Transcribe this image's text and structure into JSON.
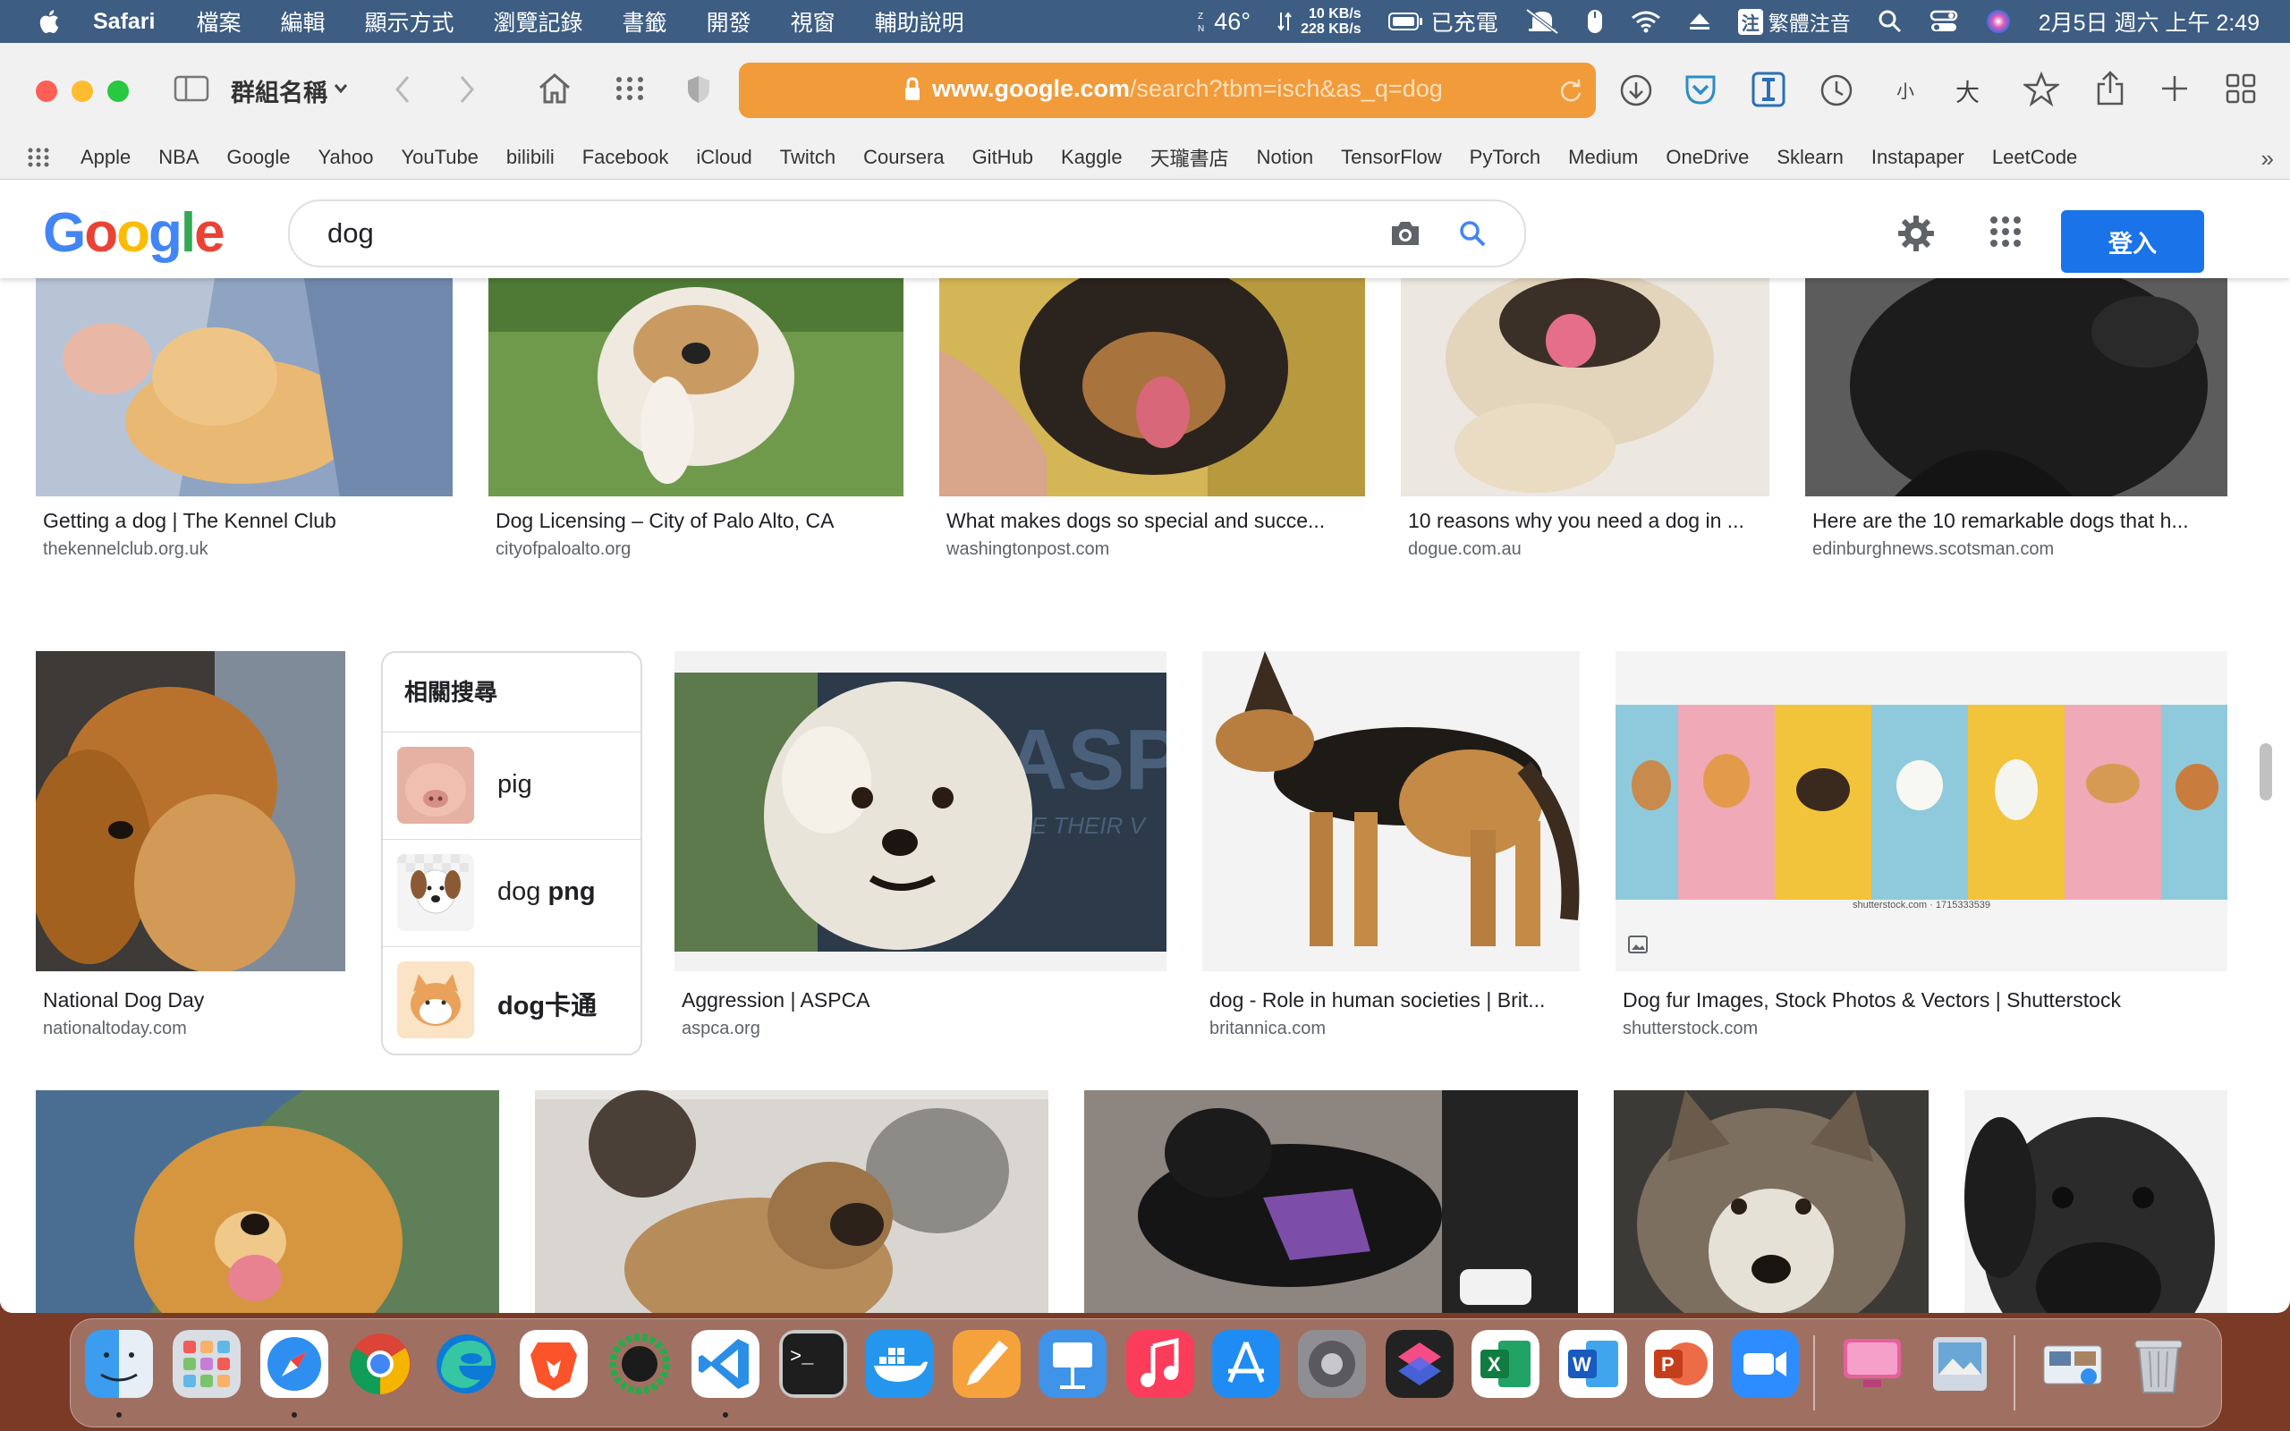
{
  "menubar": {
    "app_name": "Safari",
    "menus": [
      "檔案",
      "編輯",
      "顯示方式",
      "瀏覽記錄",
      "書籤",
      "開發",
      "視窗",
      "輔助說明"
    ],
    "temperature": "46°",
    "net_up": "10 KB/s",
    "net_down": "228 KB/s",
    "battery_status": "已充電",
    "input_method_badge": "注",
    "input_method": "繁體注音",
    "datetime": "2月5日 週六 上午 2:49"
  },
  "toolbar": {
    "group_name": "群組名稱",
    "url_domain": "www.google.com",
    "url_path": "/search?tbm=isch&as_q=dog",
    "zoom_small": "小",
    "zoom_large": "大"
  },
  "favorites": [
    "Apple",
    "NBA",
    "Google",
    "Yahoo",
    "YouTube",
    "bilibili",
    "Facebook",
    "iCloud",
    "Twitch",
    "Coursera",
    "GitHub",
    "Kaggle",
    "天瓏書店",
    "Notion",
    "TensorFlow",
    "PyTorch",
    "Medium",
    "OneDrive",
    "Sklearn",
    "Instapaper",
    "LeetCode"
  ],
  "google": {
    "logo": "Google",
    "query": "dog",
    "signin_label": "登入"
  },
  "results": [
    {
      "title": "Getting a dog | The Kennel Club",
      "source": "thekennelclub.org.uk"
    },
    {
      "title": "Dog Licensing – City of Palo Alto, CA",
      "source": "cityofpaloalto.org"
    },
    {
      "title": "What makes dogs so special and succe...",
      "source": "washingtonpost.com"
    },
    {
      "title": "10 reasons why you need a dog in ...",
      "source": "dogue.com.au"
    },
    {
      "title": "Here are the 10 remarkable dogs that h...",
      "source": "edinburghnews.scotsman.com"
    },
    {
      "title": "National Dog Day",
      "source": "nationaltoday.com"
    },
    {
      "title": "Aggression | ASPCA",
      "source": "aspca.org"
    },
    {
      "title": "dog - Role in human societies | Brit...",
      "source": "britannica.com"
    },
    {
      "title": "Dog fur Images, Stock Photos & Vectors | Shutterstock",
      "source": "shutterstock.com"
    }
  ],
  "related": {
    "heading": "相關搜尋",
    "items": [
      {
        "plain": "pig",
        "bold": ""
      },
      {
        "plain": "dog ",
        "bold": "png"
      },
      {
        "plain": "",
        "bold": "dog卡通"
      }
    ]
  },
  "aspca_watermark": "ASPC",
  "aspca_watermark_sub": "HE THEIR V",
  "shutterstock_caption": "shutterstock.com · 1715333539"
}
